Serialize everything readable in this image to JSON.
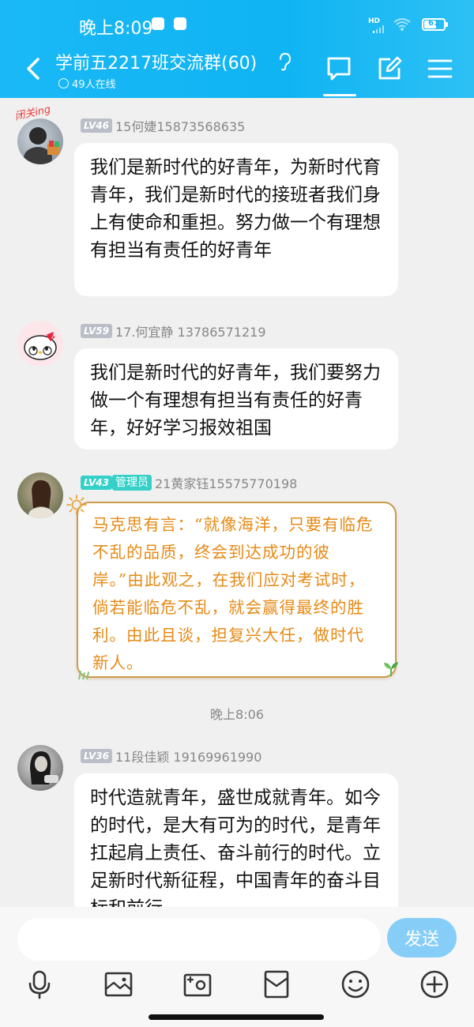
{
  "status_bar": {
    "time": "晚上8:09",
    "battery": "61",
    "battery_level": 0.61,
    "network": "HD"
  },
  "header": {
    "title": "学前五2217班交流群(60)",
    "online": "49人在线",
    "icons": [
      "back-icon",
      "hearing-icon",
      "chat-icon",
      "edit-icon",
      "menu-icon"
    ]
  },
  "messages": [
    {
      "level": "LV46",
      "sender": "15何婕15873568635",
      "avatar_tag": "闭关ing",
      "text": "我们是新时代的好青年，为新时代育青年，我们是新时代的接班者我们身上有使命和重担。努力做一个有理想有担当有责任的好青年"
    },
    {
      "level": "LV59",
      "sender": "17.何宜静 13786571219",
      "text": "我们是新时代的好青年，我们要努力做一个有理想有担当有责任的好青年，好好学习报效祖国"
    },
    {
      "level": "LV43",
      "role": "管理员",
      "sender": "21黄家钰15575770198",
      "text": "马克思有言：“就像海洋，只要有临危不乱的品质，终会到达成功的彼岸。”由此观之，在我们应对考试时，倘若能临危不乱，就会赢得最终的胜利。由此且谈，担复兴大任，做时代新人。"
    },
    {
      "level": "LV36",
      "sender": "11段佳颖 19169961990",
      "text": "时代造就青年，盛世成就青年。如今的时代，是大有可为的时代，是青年扛起肩上责任、奋斗前行的时代。立足新时代新征程，中国青年的奋斗目标和前行"
    }
  ],
  "timestamp": "晚上8:06",
  "input": {
    "placeholder": "",
    "value": "",
    "send_label": "发送"
  },
  "toolbar": [
    "microphone-icon",
    "image-icon",
    "camera-icon",
    "red-packet-icon",
    "emoji-icon",
    "plus-icon"
  ],
  "colors": {
    "header": "#10b4f3",
    "send_button": "#86cef7",
    "fancy_text": "#e68a16",
    "level_badge": "#b9bec7",
    "admin_badge": "#35d0c8"
  }
}
